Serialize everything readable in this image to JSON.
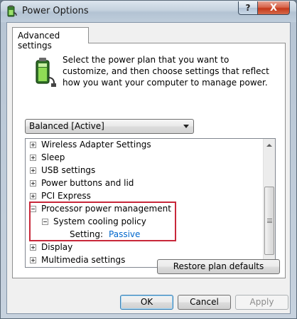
{
  "window": {
    "title": "Power Options",
    "help_label": "?",
    "close_label": "X"
  },
  "tab": {
    "label": "Advanced settings"
  },
  "description": "Select the power plan that you want to customize, and then choose settings that reflect how you want your computer to manage power.",
  "plan_select": {
    "value": "Balanced [Active]"
  },
  "tree": {
    "items": [
      {
        "label": "Wireless Adapter Settings",
        "expander": "+"
      },
      {
        "label": "Sleep",
        "expander": "+"
      },
      {
        "label": "USB settings",
        "expander": "+"
      },
      {
        "label": "Power buttons and lid",
        "expander": "+"
      },
      {
        "label": "PCI Express",
        "expander": "+"
      },
      {
        "label": "Processor power management",
        "expander": "-"
      },
      {
        "label": "System cooling policy",
        "expander": "-"
      },
      {
        "label": "Setting:",
        "value": "Passive"
      },
      {
        "label": "Display",
        "expander": "+"
      },
      {
        "label": "Multimedia settings",
        "expander": "+"
      }
    ]
  },
  "buttons": {
    "restore": "Restore plan defaults",
    "ok": "OK",
    "cancel": "Cancel",
    "apply": "Apply"
  },
  "colors": {
    "highlight_box": "#c8283a",
    "setting_value": "#0066cc"
  },
  "icons": [
    "power-options-icon",
    "battery-plug-icon",
    "chevron-down-icon",
    "scroll-up-icon",
    "scroll-down-icon"
  ]
}
